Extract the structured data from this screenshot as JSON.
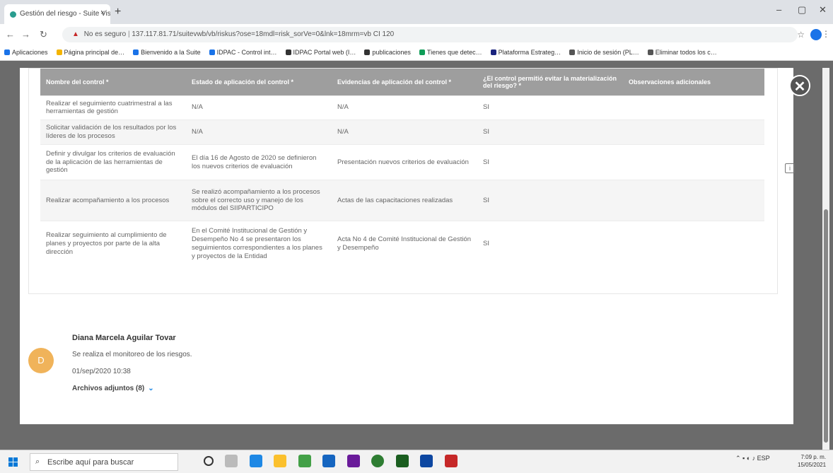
{
  "browser": {
    "tab_title": "Gestión del riesgo - Suite Visió…",
    "tab_close": "×",
    "new_tab": "+",
    "insecure_label": "No es seguro",
    "url": "137.117.81.71/suitevwb/vb/riskus?ose=18mdl=risk_sorVe=0&lnk=18mrm=vb CI 120",
    "bookmarks": [
      "Aplicaciones",
      "Página principal de…",
      "Bienvenido a la Suite",
      "IDPAC - Control int…",
      "IDPAC Portal web (I…",
      "publicaciones",
      "Tienes que detec…",
      "Plataforma Estrateg…",
      "Inicio de sesión (PL…",
      "Eliminar todos los c…"
    ],
    "bookmark_colors": [
      "#1a73e8",
      "#f4b400",
      "#1a73e8",
      "#1a73e8",
      "#333333",
      "#333333",
      "#0f9d58",
      "#1a237e",
      "#555555",
      "#555555"
    ]
  },
  "table": {
    "headers": [
      "Nombre del control *",
      "Estado de aplicación del control *",
      "Evidencias de aplicación del control *",
      "¿El control permitió evitar la materialización del riesgo? *",
      "Observaciones adicionales"
    ],
    "rows": [
      [
        "Realizar el seguimiento cuatrimestral a las herramientas de gestión",
        "N/A",
        "N/A",
        "SI",
        ""
      ],
      [
        "Solicitar validación de los resultados por los líderes de los procesos",
        "N/A",
        "N/A",
        "SI",
        ""
      ],
      [
        "Definir y divulgar los criterios de evaluación de la aplicación de las herramientas de gestión",
        "El día 16 de Agosto de 2020 se definieron los nuevos criterios de evaluación",
        "Presentación nuevos criterios de evaluación",
        "SI",
        ""
      ],
      [
        "Realizar acompañamiento a los procesos",
        "Se realizó acompañamiento a los procesos sobre el correcto uso y manejo de los módulos del SIIPARTICIPO",
        "Actas de las capacitaciones realizadas",
        "SI",
        ""
      ],
      [
        "Realizar seguimiento al cumplimiento de planes y proyectos por parte de la alta dirección",
        "En el Comité Institucional de Gestión y Desempeño No 4 se presentaron los seguimientos correspondientes a los planes y proyectos de la Entidad",
        "Acta No 4 de Comité Institucional de Gestión y Desempeño",
        "SI",
        ""
      ]
    ]
  },
  "modal": {
    "close_symbol": "✕"
  },
  "comment": {
    "avatar_letter": "D",
    "author": "Diana Marcela Aguilar Tovar",
    "text": "Se realiza el monitoreo de los riesgos.",
    "date": "01/sep/2020 10:38",
    "attachments": "Archivos adjuntos (8)"
  },
  "taskbar": {
    "search_placeholder": "Escribe aquí para buscar",
    "lang": "ESP",
    "time": "7:09 p. m.",
    "date": "15/05/2021"
  }
}
